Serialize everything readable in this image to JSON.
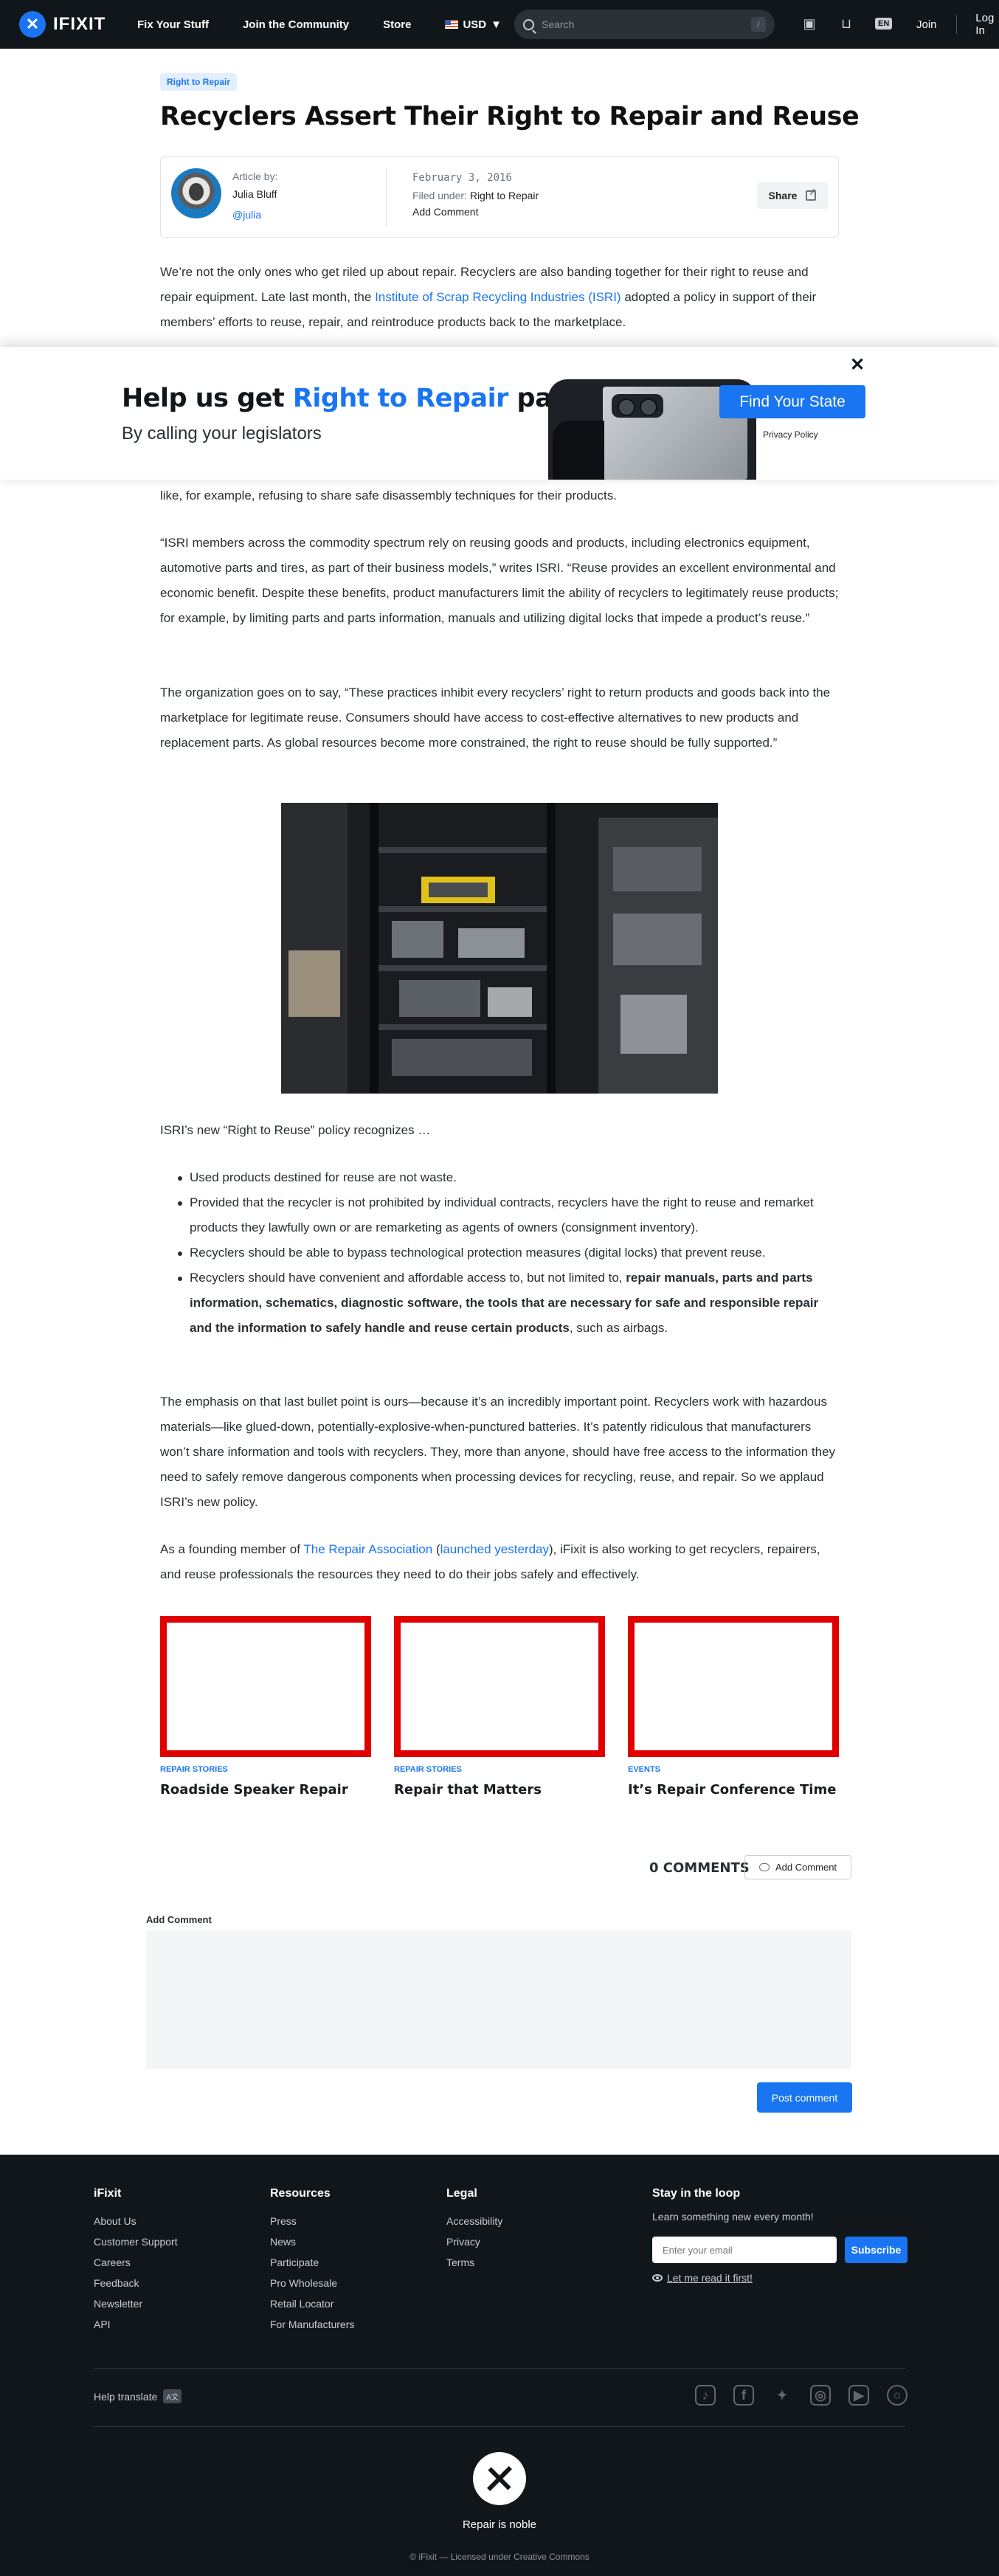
{
  "header": {
    "logo_text": "IFIXIT",
    "nav": [
      "Fix Your Stuff",
      "Join the Community",
      "Store"
    ],
    "currency": "USD",
    "search_placeholder": "Search",
    "search_shortcut": "/",
    "lang": "EN",
    "join": "Join",
    "login": "Log In"
  },
  "article": {
    "tag": "Right to Repair",
    "title": "Recyclers Assert Their Right to Repair and Reuse",
    "meta": {
      "article_by": "Article by:",
      "author": "Julia Bluff",
      "handle": "@julia",
      "date": "February 3, 2016",
      "filed_under_label": "Filed under:",
      "filed_under": "Right to Repair",
      "add_comment": "Add Comment",
      "share": "Share"
    },
    "p1_a": "We’re not the only ones who get riled up about repair. Recyclers are also banding together for their right to reuse and repair equipment. Late last month, the ",
    "p1_link": "Institute of Scrap Recycling Industries (ISRI)",
    "p1_b": " adopted a policy in support of their members’ efforts to reuse, repair, and reintroduce products back to the marketplace.",
    "p2_tail": "like, for example, refusing to share safe disassembly techniques for their products.",
    "p3": "“ISRI members across the commodity spectrum rely on reusing goods and products, including electronics equipment, automotive parts and tires, as part of their business models,” writes ISRI. “Reuse provides an excellent environmental and economic benefit. Despite these benefits, product manufacturers limit the ability of recyclers to legitimately reuse products; for example, by limiting parts and parts information, manuals and utilizing digital locks that impede a product’s reuse.”",
    "p4": "The organization goes on to say, “These practices inhibit every recyclers’ right to return products and goods back into the marketplace for legitimate reuse. Consumers should have access to cost-effective alternatives to new products and replacement parts. As global resources become more constrained, the right to reuse should be fully supported.”",
    "p5": "ISRI’s new “Right to Reuse” policy recognizes …",
    "bullets": [
      "Used products destined for reuse are not waste.",
      "Provided that the recycler is not prohibited by individual contracts, recyclers have the right to reuse and remarket products they lawfully own or are remarketing as agents of owners (consignment inventory).",
      "Recyclers should be able to bypass technological protection measures (digital locks) that prevent reuse."
    ],
    "bullet4_a": "Recyclers should have convenient and affordable access to, but not limited to, ",
    "bullet4_bold": "repair manuals, parts and parts information, schematics, diagnostic software, the tools that are necessary for safe and responsible repair and the information to safely handle and reuse certain products",
    "bullet4_b": ", such as airbags.",
    "p6": "The emphasis on that last bullet point is ours—because it’s an incredibly important point. Recyclers work with hazardous materials—like glued-down, potentially-explosive-when-punctured batteries. It’s patently ridiculous that manufacturers won’t share  information and tools with recyclers. They, more than anyone, should have free access to the information they need to safely remove dangerous components when processing devices for recycling, reuse, and repair. So we applaud ISRI’s new policy.",
    "p7_a": "As a founding member of ",
    "p7_link1": "The Repair Association",
    "p7_b": " (",
    "p7_link2": "launched yesterday",
    "p7_c": "), iFixit is also working to get recyclers, repairers, and reuse professionals the resources they need to do their jobs safely and effectively."
  },
  "banner": {
    "title_a": "Help us get ",
    "title_highlight": "Right to Repair",
    "title_b": " passed",
    "subtitle": "By calling your legislators",
    "button": "Find Your State",
    "privacy": "Privacy Policy",
    "close": "✕"
  },
  "related": [
    {
      "category": "REPAIR STORIES",
      "title": "Roadside Speaker Repair"
    },
    {
      "category": "REPAIR STORIES",
      "title": "Repair that Matters"
    },
    {
      "category": "EVENTS",
      "title": "It’s Repair Conference Time"
    }
  ],
  "comments": {
    "count_label": "0 COMMENTS",
    "add_button": "Add Comment",
    "field_label": "Add Comment",
    "post_button": "Post comment"
  },
  "footer": {
    "columns": [
      {
        "heading": "iFixit",
        "links": [
          "About Us",
          "Customer Support",
          "Careers",
          "Feedback",
          "Newsletter",
          "API"
        ]
      },
      {
        "heading": "Resources",
        "links": [
          "Press",
          "News",
          "Participate",
          "Pro Wholesale",
          "Retail Locator",
          "For Manufacturers"
        ]
      },
      {
        "heading": "Legal",
        "links": [
          "Accessibility",
          "Privacy",
          "Terms"
        ]
      }
    ],
    "newsletter": {
      "heading": "Stay in the loop",
      "text": "Learn something new every month!",
      "placeholder": "Enter your email",
      "button": "Subscribe",
      "link": "Let me read it first!"
    },
    "help_translate": "Help translate",
    "social": [
      "tiktok-icon",
      "facebook-icon",
      "twitter-icon",
      "instagram-icon",
      "youtube-icon",
      "repair-org-icon"
    ],
    "motto": "Repair is noble",
    "copyright": "© iFixit — Licensed under Creative Commons"
  },
  "colors": {
    "accent": "#1975f1",
    "dark": "#11161a",
    "placeholder_border": "#e00000"
  }
}
